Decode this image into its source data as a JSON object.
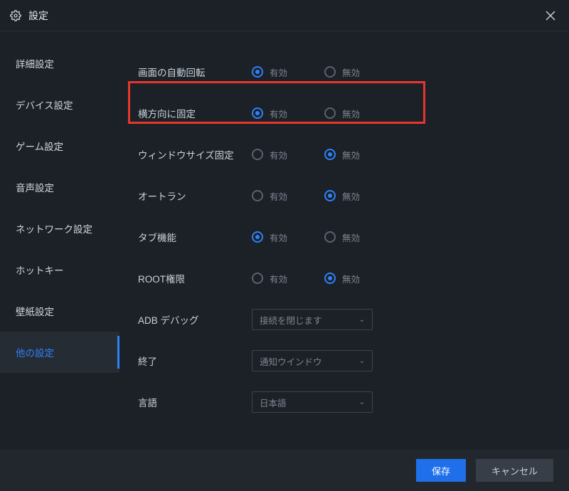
{
  "window": {
    "title": "設定"
  },
  "sidebar": {
    "items": [
      {
        "label": "詳細設定"
      },
      {
        "label": "デバイス設定"
      },
      {
        "label": "ゲーム設定"
      },
      {
        "label": "音声設定"
      },
      {
        "label": "ネットワーク設定"
      },
      {
        "label": "ホットキー"
      },
      {
        "label": "壁紙設定"
      },
      {
        "label": "他の設定"
      }
    ],
    "activeIndex": 7
  },
  "options": {
    "enabled": "有効",
    "disabled": "無効"
  },
  "rows": {
    "autoRotate": {
      "label": "画面の自動回転",
      "value": "enabled"
    },
    "lockLandscape": {
      "label": "横方向に固定",
      "value": "enabled"
    },
    "fixedWindow": {
      "label": "ウィンドウサイズ固定",
      "value": "disabled"
    },
    "autorun": {
      "label": "オートラン",
      "value": "disabled"
    },
    "tabFeature": {
      "label": "タブ機能",
      "value": "enabled"
    },
    "rootPermission": {
      "label": "ROOT権限",
      "value": "disabled"
    },
    "adbDebug": {
      "label": "ADB デバッグ",
      "selected": "接続を閉じます"
    },
    "exit": {
      "label": "終了",
      "selected": "通知ウインドウ"
    },
    "language": {
      "label": "言語",
      "selected": "日本語"
    }
  },
  "footer": {
    "save": "保存",
    "cancel": "キャンセル"
  }
}
